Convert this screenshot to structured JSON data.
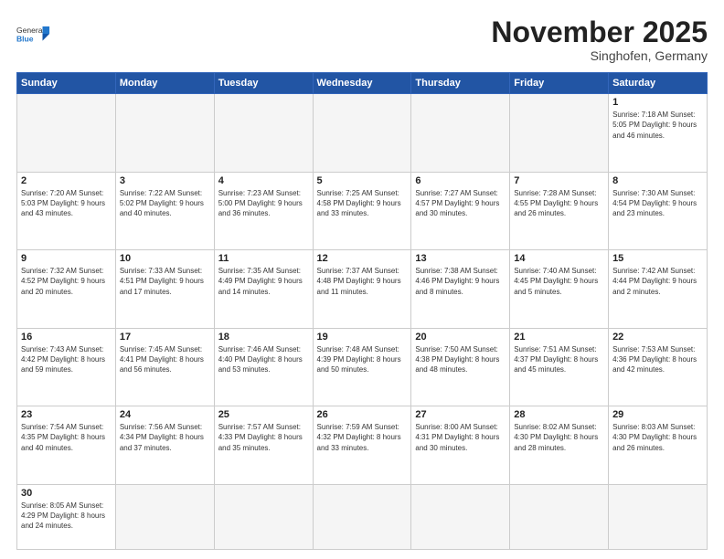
{
  "header": {
    "logo_general": "General",
    "logo_blue": "Blue",
    "month_title": "November 2025",
    "subtitle": "Singhofen, Germany"
  },
  "weekdays": [
    "Sunday",
    "Monday",
    "Tuesday",
    "Wednesday",
    "Thursday",
    "Friday",
    "Saturday"
  ],
  "days": {
    "d1": {
      "num": "1",
      "info": "Sunrise: 7:18 AM\nSunset: 5:05 PM\nDaylight: 9 hours\nand 46 minutes."
    },
    "d2": {
      "num": "2",
      "info": "Sunrise: 7:20 AM\nSunset: 5:03 PM\nDaylight: 9 hours\nand 43 minutes."
    },
    "d3": {
      "num": "3",
      "info": "Sunrise: 7:22 AM\nSunset: 5:02 PM\nDaylight: 9 hours\nand 40 minutes."
    },
    "d4": {
      "num": "4",
      "info": "Sunrise: 7:23 AM\nSunset: 5:00 PM\nDaylight: 9 hours\nand 36 minutes."
    },
    "d5": {
      "num": "5",
      "info": "Sunrise: 7:25 AM\nSunset: 4:58 PM\nDaylight: 9 hours\nand 33 minutes."
    },
    "d6": {
      "num": "6",
      "info": "Sunrise: 7:27 AM\nSunset: 4:57 PM\nDaylight: 9 hours\nand 30 minutes."
    },
    "d7": {
      "num": "7",
      "info": "Sunrise: 7:28 AM\nSunset: 4:55 PM\nDaylight: 9 hours\nand 26 minutes."
    },
    "d8": {
      "num": "8",
      "info": "Sunrise: 7:30 AM\nSunset: 4:54 PM\nDaylight: 9 hours\nand 23 minutes."
    },
    "d9": {
      "num": "9",
      "info": "Sunrise: 7:32 AM\nSunset: 4:52 PM\nDaylight: 9 hours\nand 20 minutes."
    },
    "d10": {
      "num": "10",
      "info": "Sunrise: 7:33 AM\nSunset: 4:51 PM\nDaylight: 9 hours\nand 17 minutes."
    },
    "d11": {
      "num": "11",
      "info": "Sunrise: 7:35 AM\nSunset: 4:49 PM\nDaylight: 9 hours\nand 14 minutes."
    },
    "d12": {
      "num": "12",
      "info": "Sunrise: 7:37 AM\nSunset: 4:48 PM\nDaylight: 9 hours\nand 11 minutes."
    },
    "d13": {
      "num": "13",
      "info": "Sunrise: 7:38 AM\nSunset: 4:46 PM\nDaylight: 9 hours\nand 8 minutes."
    },
    "d14": {
      "num": "14",
      "info": "Sunrise: 7:40 AM\nSunset: 4:45 PM\nDaylight: 9 hours\nand 5 minutes."
    },
    "d15": {
      "num": "15",
      "info": "Sunrise: 7:42 AM\nSunset: 4:44 PM\nDaylight: 9 hours\nand 2 minutes."
    },
    "d16": {
      "num": "16",
      "info": "Sunrise: 7:43 AM\nSunset: 4:42 PM\nDaylight: 8 hours\nand 59 minutes."
    },
    "d17": {
      "num": "17",
      "info": "Sunrise: 7:45 AM\nSunset: 4:41 PM\nDaylight: 8 hours\nand 56 minutes."
    },
    "d18": {
      "num": "18",
      "info": "Sunrise: 7:46 AM\nSunset: 4:40 PM\nDaylight: 8 hours\nand 53 minutes."
    },
    "d19": {
      "num": "19",
      "info": "Sunrise: 7:48 AM\nSunset: 4:39 PM\nDaylight: 8 hours\nand 50 minutes."
    },
    "d20": {
      "num": "20",
      "info": "Sunrise: 7:50 AM\nSunset: 4:38 PM\nDaylight: 8 hours\nand 48 minutes."
    },
    "d21": {
      "num": "21",
      "info": "Sunrise: 7:51 AM\nSunset: 4:37 PM\nDaylight: 8 hours\nand 45 minutes."
    },
    "d22": {
      "num": "22",
      "info": "Sunrise: 7:53 AM\nSunset: 4:36 PM\nDaylight: 8 hours\nand 42 minutes."
    },
    "d23": {
      "num": "23",
      "info": "Sunrise: 7:54 AM\nSunset: 4:35 PM\nDaylight: 8 hours\nand 40 minutes."
    },
    "d24": {
      "num": "24",
      "info": "Sunrise: 7:56 AM\nSunset: 4:34 PM\nDaylight: 8 hours\nand 37 minutes."
    },
    "d25": {
      "num": "25",
      "info": "Sunrise: 7:57 AM\nSunset: 4:33 PM\nDaylight: 8 hours\nand 35 minutes."
    },
    "d26": {
      "num": "26",
      "info": "Sunrise: 7:59 AM\nSunset: 4:32 PM\nDaylight: 8 hours\nand 33 minutes."
    },
    "d27": {
      "num": "27",
      "info": "Sunrise: 8:00 AM\nSunset: 4:31 PM\nDaylight: 8 hours\nand 30 minutes."
    },
    "d28": {
      "num": "28",
      "info": "Sunrise: 8:02 AM\nSunset: 4:30 PM\nDaylight: 8 hours\nand 28 minutes."
    },
    "d29": {
      "num": "29",
      "info": "Sunrise: 8:03 AM\nSunset: 4:30 PM\nDaylight: 8 hours\nand 26 minutes."
    },
    "d30": {
      "num": "30",
      "info": "Sunrise: 8:05 AM\nSunset: 4:29 PM\nDaylight: 8 hours\nand 24 minutes."
    }
  }
}
